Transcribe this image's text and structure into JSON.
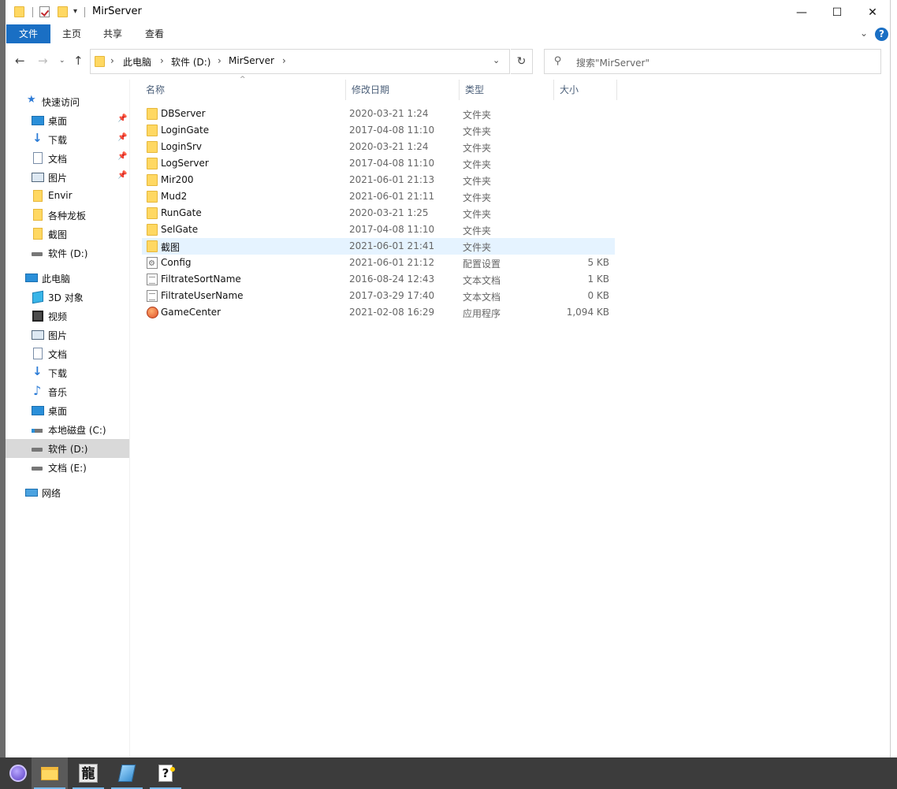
{
  "window": {
    "title": "MirServer",
    "controls": {
      "minimize": "—",
      "maximize": "☐",
      "close": "✕"
    }
  },
  "ribbon": {
    "tabs": [
      "文件",
      "主页",
      "共享",
      "查看"
    ],
    "help_label": "?"
  },
  "navigation": {
    "breadcrumb": [
      "此电脑",
      "软件 (D:)",
      "MirServer"
    ],
    "search_placeholder": "搜索\"MirServer\""
  },
  "sidebar": {
    "quick_access": {
      "label": "快速访问",
      "items": [
        {
          "label": "桌面",
          "icon": "desktop-icon",
          "pinned": true
        },
        {
          "label": "下载",
          "icon": "download-icon",
          "pinned": true
        },
        {
          "label": "文档",
          "icon": "document-icon",
          "pinned": true
        },
        {
          "label": "图片",
          "icon": "pictures-icon",
          "pinned": true
        },
        {
          "label": "Envir",
          "icon": "folder-icon",
          "pinned": false
        },
        {
          "label": "各种龙板",
          "icon": "folder-icon",
          "pinned": false
        },
        {
          "label": "截图",
          "icon": "folder-icon",
          "pinned": false
        },
        {
          "label": "软件 (D:)",
          "icon": "drive-icon",
          "pinned": false
        }
      ]
    },
    "this_pc": {
      "label": "此电脑",
      "items": [
        {
          "label": "3D 对象",
          "icon": "3d-objects-icon"
        },
        {
          "label": "视频",
          "icon": "video-icon"
        },
        {
          "label": "图片",
          "icon": "pictures-icon"
        },
        {
          "label": "文档",
          "icon": "document-icon"
        },
        {
          "label": "下载",
          "icon": "download-icon"
        },
        {
          "label": "音乐",
          "icon": "music-icon"
        },
        {
          "label": "桌面",
          "icon": "desktop-icon"
        },
        {
          "label": "本地磁盘 (C:)",
          "icon": "system-drive-icon"
        },
        {
          "label": "软件 (D:)",
          "icon": "drive-icon",
          "selected": true
        },
        {
          "label": "文档 (E:)",
          "icon": "drive-icon"
        }
      ]
    },
    "network": {
      "label": "网络"
    }
  },
  "file_list": {
    "columns": [
      "名称",
      "修改日期",
      "类型",
      "大小"
    ],
    "rows": [
      {
        "name": "DBServer",
        "date": "2020-03-21 1:24",
        "type": "文件夹",
        "size": "",
        "icon": "folder"
      },
      {
        "name": "LoginGate",
        "date": "2017-04-08 11:10",
        "type": "文件夹",
        "size": "",
        "icon": "folder"
      },
      {
        "name": "LoginSrv",
        "date": "2020-03-21 1:24",
        "type": "文件夹",
        "size": "",
        "icon": "folder"
      },
      {
        "name": "LogServer",
        "date": "2017-04-08 11:10",
        "type": "文件夹",
        "size": "",
        "icon": "folder"
      },
      {
        "name": "Mir200",
        "date": "2021-06-01 21:13",
        "type": "文件夹",
        "size": "",
        "icon": "folder"
      },
      {
        "name": "Mud2",
        "date": "2021-06-01 21:11",
        "type": "文件夹",
        "size": "",
        "icon": "folder"
      },
      {
        "name": "RunGate",
        "date": "2020-03-21 1:25",
        "type": "文件夹",
        "size": "",
        "icon": "folder"
      },
      {
        "name": "SelGate",
        "date": "2017-04-08 11:10",
        "type": "文件夹",
        "size": "",
        "icon": "folder"
      },
      {
        "name": "截图",
        "date": "2021-06-01 21:41",
        "type": "文件夹",
        "size": "",
        "icon": "folder",
        "highlighted": true
      },
      {
        "name": "Config",
        "date": "2021-06-01 21:12",
        "type": "配置设置",
        "size": "5 KB",
        "icon": "config"
      },
      {
        "name": "FiltrateSortName",
        "date": "2016-08-24 12:43",
        "type": "文本文档",
        "size": "1 KB",
        "icon": "text"
      },
      {
        "name": "FiltrateUserName",
        "date": "2017-03-29 17:40",
        "type": "文本文档",
        "size": "0 KB",
        "icon": "text"
      },
      {
        "name": "GameCenter",
        "date": "2021-02-08 16:29",
        "type": "应用程序",
        "size": "1,094 KB",
        "icon": "app"
      }
    ]
  },
  "taskbar": {
    "items": [
      {
        "icon": "start-orb-icon",
        "active": false
      },
      {
        "icon": "file-explorer-icon",
        "active": true
      },
      {
        "icon": "dragon-app-icon",
        "label": "龍",
        "active": false
      },
      {
        "icon": "book-app-icon",
        "active": false
      },
      {
        "icon": "help-file-icon",
        "label": "?",
        "active": false
      }
    ]
  },
  "colors": {
    "accent": "#1a6fc4",
    "folder": "#ffd862",
    "row_highlight": "#e5f3ff",
    "sidebar_selected": "#d9d9d9",
    "taskbar": "#3c3c3c"
  }
}
